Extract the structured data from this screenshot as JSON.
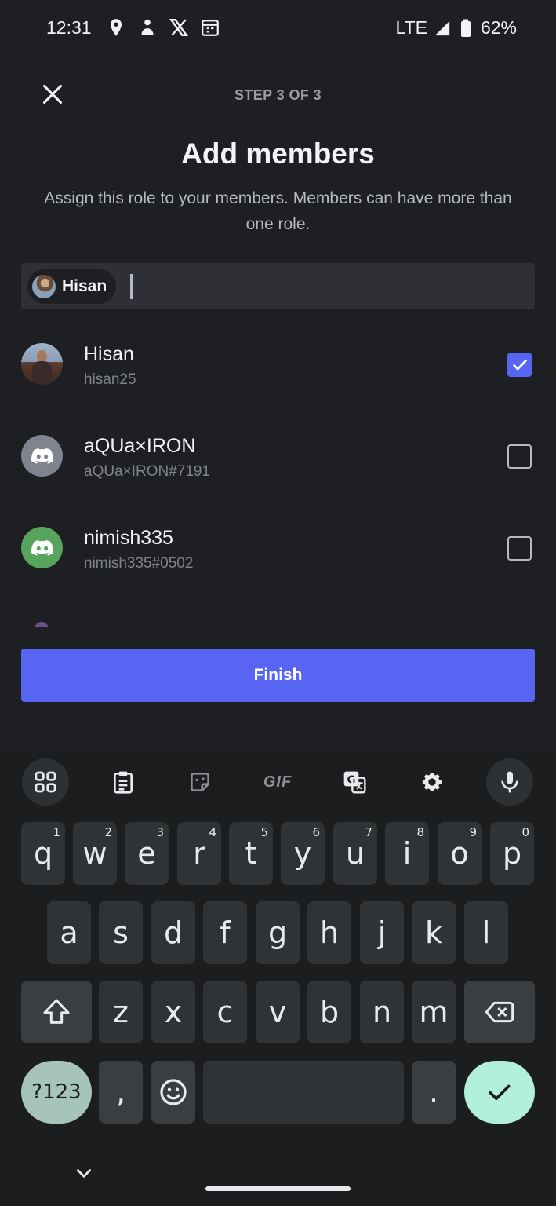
{
  "status_bar": {
    "time": "12:31",
    "icons_left": [
      "location-pin-icon",
      "person-icon",
      "x-logo-icon",
      "calendar-icon"
    ],
    "network": "LTE",
    "battery": "62%"
  },
  "header": {
    "step": "STEP 3 OF 3",
    "title": "Add members",
    "subtitle": "Assign this role to your members. Members can have more than one role."
  },
  "search": {
    "chips": [
      {
        "label": "Hisan"
      }
    ],
    "value": ""
  },
  "members": [
    {
      "name": "Hisan",
      "handle": "hisan25",
      "checked": true,
      "avatar": "photo"
    },
    {
      "name": "aQUa×IRON",
      "handle": "aQUa×IRON#7191",
      "checked": false,
      "avatar": "discord-grey",
      "avatar_color": "#80848e"
    },
    {
      "name": "nimish335",
      "handle": "nimish335#0502",
      "checked": false,
      "avatar": "discord-green",
      "avatar_color": "#57a55d"
    }
  ],
  "finish_label": "Finish",
  "keyboard": {
    "toolbar": [
      "apps-grid-icon",
      "clipboard-icon",
      "sticker-icon",
      "GIF",
      "translate-icon",
      "settings-gear-icon",
      "microphone-icon"
    ],
    "gif_label": "GIF",
    "row1": [
      {
        "k": "q",
        "h": "1"
      },
      {
        "k": "w",
        "h": "2"
      },
      {
        "k": "e",
        "h": "3"
      },
      {
        "k": "r",
        "h": "4"
      },
      {
        "k": "t",
        "h": "5"
      },
      {
        "k": "y",
        "h": "6"
      },
      {
        "k": "u",
        "h": "7"
      },
      {
        "k": "i",
        "h": "8"
      },
      {
        "k": "o",
        "h": "9"
      },
      {
        "k": "p",
        "h": "0"
      }
    ],
    "row2": [
      "a",
      "s",
      "d",
      "f",
      "g",
      "h",
      "j",
      "k",
      "l"
    ],
    "row3": [
      "z",
      "x",
      "c",
      "v",
      "b",
      "n",
      "m"
    ],
    "num_key": "?123",
    "comma": ",",
    "period": "."
  },
  "colors": {
    "background": "#1e1f22",
    "accent": "#5865f2",
    "input_bg": "#2e3035",
    "enter_key": "#b2f0dc"
  }
}
